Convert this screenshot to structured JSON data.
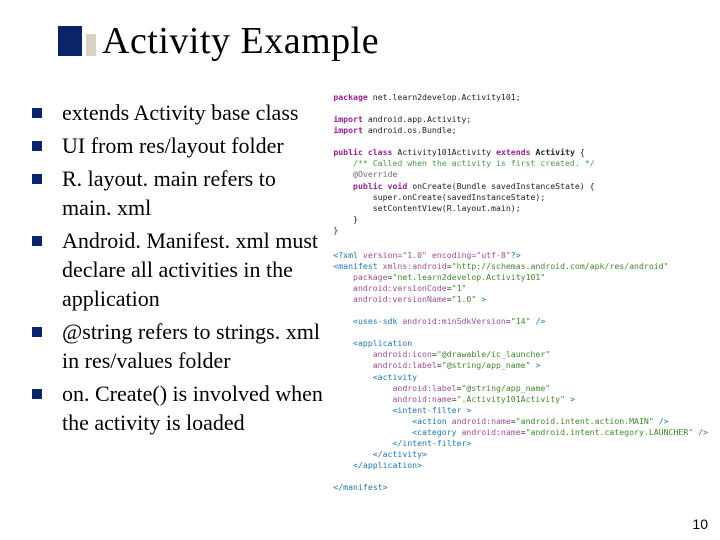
{
  "title": "Activity Example",
  "bullets": [
    "extends Activity base class",
    "UI from res/layout folder",
    "R. layout. main refers to main. xml",
    "Android. Manifest. xml must declare all activities in the application",
    "@string refers to strings. xml in res/values folder",
    "on. Create() is involved when the activity is loaded"
  ],
  "code": {
    "java": {
      "package_kw": "package",
      "package_name": "net.learn2develop.Activity101;",
      "import_kw": "import",
      "imports": [
        "android.app.Activity;",
        "android.os.Bundle;"
      ],
      "class_decl_pre": "public class",
      "class_name": "Activity101Activity",
      "extends_kw": "extends",
      "super_class": "Activity",
      "comment": "/** Called when the activity is first created. */",
      "annotation": "@Override",
      "method_sig_pre": "public void",
      "method_name": "onCreate(Bundle savedInstanceState) {",
      "body1": "super.onCreate(savedInstanceState);",
      "body2": "setContentView(R.layout.main);",
      "close1": "}",
      "close2": "}"
    },
    "xml": {
      "decl_open": "<?xml",
      "decl_attrs": " version=\"1.0\" encoding=\"utf-8\"",
      "decl_close": "?>",
      "manifest_open": "<manifest",
      "manifest_xmlns_attr": "xmlns:android",
      "manifest_xmlns_val": "\"http://schemas.android.com/apk/res/android\"",
      "manifest_pkg_attr": "package",
      "manifest_pkg_val": "\"net.learn2develop.Activity101\"",
      "manifest_vc_attr": "android:versionCode",
      "manifest_vc_val": "\"1\"",
      "manifest_vn_attr": "android:versionName",
      "manifest_vn_val": "\"1.0\"",
      "gt": ">",
      "uses_sdk_open": "<uses-sdk",
      "uses_sdk_attr": "android:minSdkVersion",
      "uses_sdk_val": "\"14\"",
      "self_close": " />",
      "app_open": "<application",
      "app_icon_attr": "android:icon",
      "app_icon_val": "\"@drawable/ic_launcher\"",
      "app_label_attr": "android:label",
      "app_label_val": "\"@string/app_name\"",
      "act_open": "<activity",
      "act_label_attr": "android:label",
      "act_label_val": "\"@string/app_name\"",
      "act_name_attr": "android:name",
      "act_name_val": "\".Activity101Activity\"",
      "if_open": "<intent-filter",
      "action_open": "<action",
      "action_attr": "android:name",
      "action_val": "\"android.intent.action.MAIN\"",
      "cat_open": "<category",
      "cat_attr": "android:name",
      "cat_val": "\"android.intent.category.LAUNCHER\"",
      "if_close": "</intent-filter>",
      "act_close": "</activity>",
      "app_close": "</application>",
      "manifest_close": "</manifest>"
    }
  },
  "page_number": "10"
}
